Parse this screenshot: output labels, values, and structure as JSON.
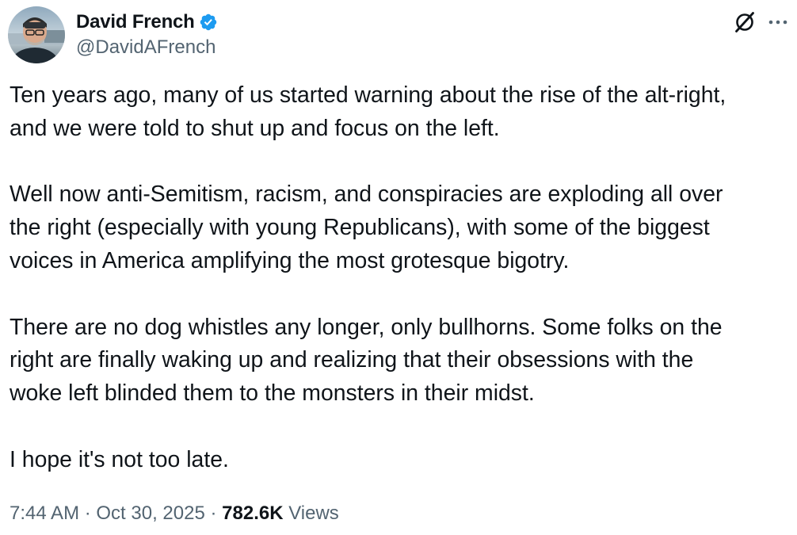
{
  "author": {
    "display_name": "David French",
    "handle": "@DavidAFrench",
    "verified": true
  },
  "icons": {
    "verified": "verified-badge-icon",
    "grok": "grok-icon",
    "more": "more-options-icon",
    "avatar": "profile-photo"
  },
  "colors": {
    "text": "#0f1419",
    "secondary": "#536471",
    "verified_blue": "#1d9bf0"
  },
  "tweet": {
    "paragraphs": [
      "Ten years ago, many of us started warning about the rise of the alt-right,\nand we were told to shut up and focus on the left.",
      "Well now anti-Semitism, racism, and conspiracies are exploding all over\nthe right (especially with young Republicans), with some of the biggest\nvoices in America amplifying the most grotesque bigotry.",
      "There are no dog whistles any longer, only bullhorns. Some folks on the\nright are finally waking up and realizing that their obsessions with the\nwoke left blinded them to the monsters in their midst.",
      "I hope it's not too late."
    ]
  },
  "meta": {
    "time": "7:44 AM",
    "separator": " · ",
    "date": "Oct 30, 2025",
    "views_count": "782.6K",
    "views_label": " Views"
  }
}
